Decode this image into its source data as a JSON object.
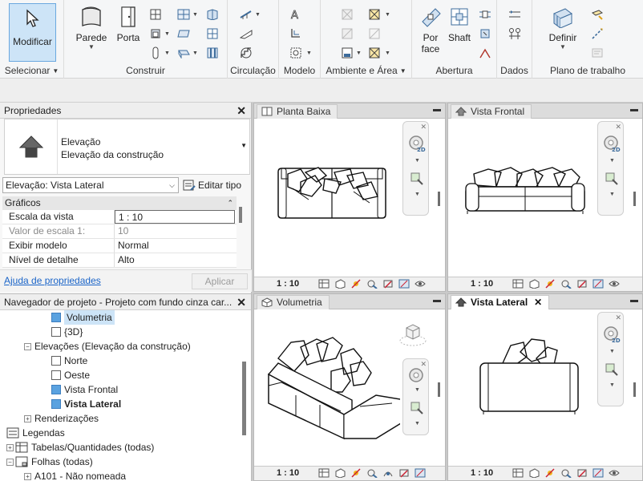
{
  "ribbon": {
    "modify": {
      "label": "Modificar"
    },
    "select": {
      "label": "Selecionar"
    },
    "build": {
      "wall": "Parede",
      "door": "Porta",
      "panel": "Construir"
    },
    "circulation": {
      "panel": "Circulação"
    },
    "model": {
      "panel": "Modelo"
    },
    "room_area": {
      "panel": "Ambiente e Área"
    },
    "opening": {
      "by_face": "Por\nface",
      "shaft": "Shaft",
      "panel": "Abertura"
    },
    "datum": {
      "panel": "Dados"
    },
    "work_plane": {
      "define": "Definir",
      "panel": "Plano de trabalho"
    }
  },
  "properties": {
    "title": "Propriedades",
    "type_line1": "Elevação",
    "type_line2": "Elevação da construção",
    "selector": "Elevação: Vista Lateral",
    "edit_type": "Editar tipo",
    "group": "Gráficos",
    "rows": [
      {
        "key": "Escala da vista",
        "value": "1 : 10"
      },
      {
        "key": "Valor de escala     1:",
        "value": "10"
      },
      {
        "key": "Exibir modelo",
        "value": "Normal"
      },
      {
        "key": "Nível de detalhe",
        "value": "Alto"
      }
    ],
    "help": "Ajuda de propriedades",
    "apply": "Aplicar"
  },
  "browser": {
    "title": "Navegador de projeto - Projeto com fundo cinza car...",
    "items": [
      {
        "label": "Volumetria"
      },
      {
        "label": "{3D}"
      },
      {
        "label": "Elevações (Elevação da construção)"
      },
      {
        "label": "Norte"
      },
      {
        "label": "Oeste"
      },
      {
        "label": "Vista Frontal"
      },
      {
        "label": "Vista Lateral"
      },
      {
        "label": "Renderizações"
      },
      {
        "label": "Legendas"
      },
      {
        "label": "Tabelas/Quantidades (todas)"
      },
      {
        "label": "Folhas (todas)"
      },
      {
        "label": "A101 - Não nomeada"
      }
    ]
  },
  "views": {
    "plan": {
      "title": "Planta Baixa",
      "scale": "1 : 10"
    },
    "front": {
      "title": "Vista Frontal",
      "scale": "1 : 10"
    },
    "volume": {
      "title": "Volumetria",
      "scale": "1 : 10"
    },
    "side": {
      "title": "Vista Lateral",
      "scale": "1 : 10"
    }
  },
  "colors": {
    "accent": "#5aa2e0",
    "selection": "#cde4f7",
    "link": "#1a64c8"
  }
}
